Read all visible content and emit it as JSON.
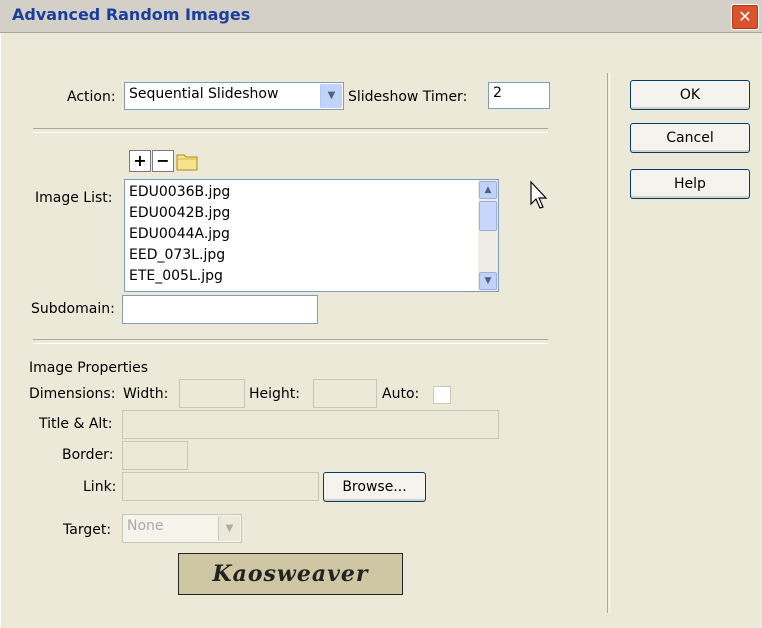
{
  "window": {
    "title": "Advanced Random Images",
    "close_label": "✕"
  },
  "action": {
    "label": "Action:",
    "value": "Sequential Slideshow",
    "timer_label": "Slideshow Timer:",
    "timer_value": "2"
  },
  "toolbar": {
    "add_label": "+",
    "remove_label": "−"
  },
  "image_list": {
    "label": "Image List:",
    "items": [
      "EDU0036B.jpg",
      "EDU0042B.jpg",
      "EDU0044A.jpg",
      "EED_073L.jpg",
      "ETE_005L.jpg"
    ]
  },
  "subdomain": {
    "label": "Subdomain:",
    "value": ""
  },
  "properties": {
    "heading": "Image Properties",
    "dimensions_label": "Dimensions:",
    "width_label": "Width:",
    "height_label": "Height:",
    "auto_label": "Auto:",
    "title_label": "Title & Alt:",
    "border_label": "Border:",
    "link_label": "Link:",
    "browse_label": "Browse...",
    "target_label": "Target:",
    "target_value": "None"
  },
  "buttons": {
    "ok": "OK",
    "cancel": "Cancel",
    "help": "Help"
  },
  "logo": {
    "text": "Kaosweaver"
  },
  "colors": {
    "title_text": "#1a3e9c",
    "close_button": "#d9532c",
    "dialog_bg": "#ece9d8",
    "field_border": "#7f9db9"
  }
}
